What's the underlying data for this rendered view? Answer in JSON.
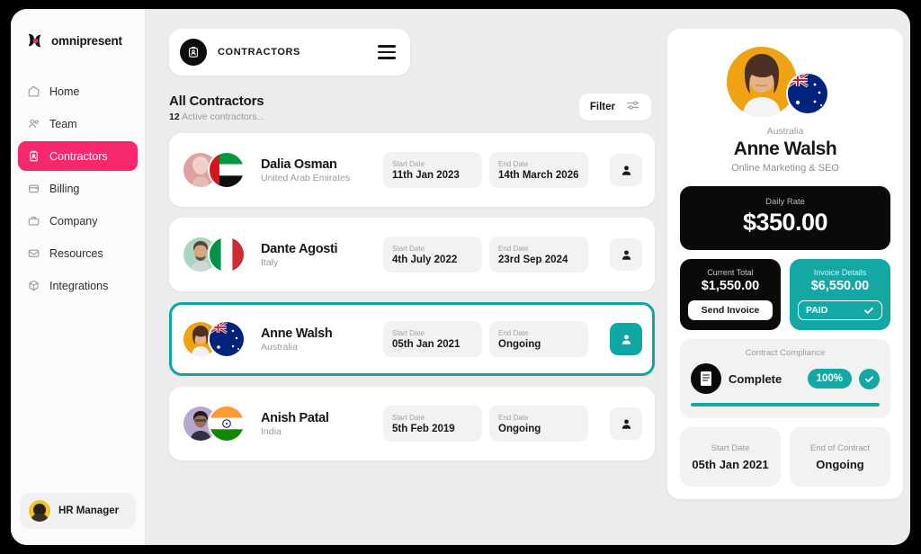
{
  "brand": {
    "name": "omnipresent",
    "logo_icon": "omnipresent-logo-mark"
  },
  "sidebar": {
    "items": [
      {
        "label": "Home",
        "icon": "home-icon",
        "active": false
      },
      {
        "label": "Team",
        "icon": "people-icon",
        "active": false
      },
      {
        "label": "Contractors",
        "icon": "clipboard-icon",
        "active": true
      },
      {
        "label": "Billing",
        "icon": "billing-icon",
        "active": false
      },
      {
        "label": "Company",
        "icon": "briefcase-icon",
        "active": false
      },
      {
        "label": "Resources",
        "icon": "envelope-icon",
        "active": false
      },
      {
        "label": "Integrations",
        "icon": "box-icon",
        "active": false
      }
    ],
    "user": {
      "name": "HR Manager",
      "avatar": "user-avatar"
    }
  },
  "topbar": {
    "title": "CONTRACTORS",
    "badge_icon": "id-badge-icon",
    "menu_icon": "hamburger-icon"
  },
  "list": {
    "title": "All Contractors",
    "count": "12",
    "subtitle_rest": "Active contractors...",
    "filter_label": "Filter",
    "filter_icon": "sliders-icon",
    "start_label": "Start Date",
    "end_label": "End Date",
    "contractors": [
      {
        "name": "Dalia Osman",
        "country": "United Arab Emirates",
        "flag": "ae",
        "avatar_bg": "#e0a0a0",
        "start_date": "11th Jan 2023",
        "end_date": "14th March 2026",
        "selected": false
      },
      {
        "name": "Dante Agosti",
        "country": "Italy",
        "flag": "it",
        "avatar_bg": "#a8d6c3",
        "start_date": "4th July 2022",
        "end_date": "23rd Sep 2024",
        "selected": false
      },
      {
        "name": "Anne Walsh",
        "country": "Australia",
        "flag": "au",
        "avatar_bg": "#efa212",
        "start_date": "05th Jan 2021",
        "end_date": "Ongoing",
        "selected": true
      },
      {
        "name": "Anish Patal",
        "country": "India",
        "flag": "in",
        "avatar_bg": "#b5a8d0",
        "start_date": "5th Feb 2019",
        "end_date": "Ongoing",
        "selected": false
      }
    ]
  },
  "detail": {
    "country": "Australia",
    "name": "Anne Walsh",
    "role": "Online Marketing & SEO",
    "flag": "au",
    "avatar_bg": "#efa212",
    "daily_rate_label": "Daily Rate",
    "daily_rate_value": "$350.00",
    "current_total_label": "Current Total",
    "current_total_value": "$1,550.00",
    "send_invoice_label": "Send Invoice",
    "invoice_label": "Invoice Details",
    "invoice_value": "$6,550.00",
    "paid_label": "PAID",
    "paid_icon": "check-icon",
    "compliance_label": "Contract Compliance",
    "compliance_status": "Complete",
    "compliance_percent": "100%",
    "compliance_progress": 100,
    "compliance_icon": "document-icon",
    "compliance_check_icon": "check-icon",
    "start_label": "Start Date",
    "start_value": "05th Jan 2021",
    "end_label": "End of Contract",
    "end_value": "Ongoing"
  },
  "colors": {
    "accent_pink": "#f6276f",
    "accent_teal": "#14a8a5",
    "dark": "#0a0a0a"
  }
}
